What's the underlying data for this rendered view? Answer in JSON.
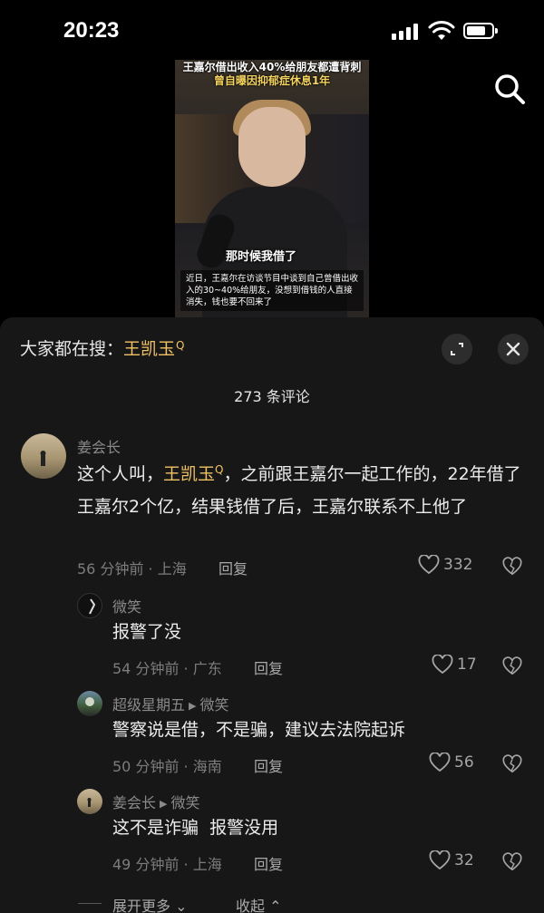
{
  "status_bar": {
    "time": "20:23"
  },
  "video": {
    "title_line1": "王嘉尔借出收入40%给朋友都遭背刺",
    "title_line2": "曾自曝因抑郁症休息1年",
    "caption": "那时候我借了",
    "subtitle": "近日，王嘉尔在访谈节目中谈到自己曾借出收入的30~40%给朋友，没想到借钱的人直接消失，钱也要不回来了"
  },
  "sheet": {
    "search_prefix": "大家都在搜：",
    "search_keyword": "王凯玉",
    "search_glyph": "Q",
    "comment_count": "273 条评论"
  },
  "comments": [
    {
      "user": "姜会长",
      "text_before": "这个人叫，",
      "keyword": "王凯玉",
      "keyword_glyph": "Q",
      "text_after": "，之前跟王嘉尔一起工作的，22年借了王嘉尔2个亿，结果钱借了后，王嘉尔联系不上他了",
      "time_loc": "56 分钟前 · 上海",
      "reply_label": "回复",
      "likes": "332"
    },
    {
      "user": "微笑",
      "text": "报警了没",
      "time_loc": "54 分钟前 · 广东",
      "reply_label": "回复",
      "likes": "17"
    },
    {
      "user": "超级星期五",
      "reply_to": "微笑",
      "text": "警察说是借，不是骗，建议去法院起诉",
      "time_loc": "50 分钟前 · 海南",
      "reply_label": "回复",
      "likes": "56"
    },
    {
      "user": "姜会长",
      "reply_to": "微笑",
      "text": "这不是诈骗  报警没用",
      "time_loc": "49 分钟前 · 上海",
      "reply_label": "回复",
      "likes": "32"
    }
  ],
  "footer": {
    "expand_more": "展开更多",
    "collapse": "收起"
  },
  "colors": {
    "keyword": "#f0c265",
    "sheet_bg": "#171717",
    "background": "#000000"
  }
}
